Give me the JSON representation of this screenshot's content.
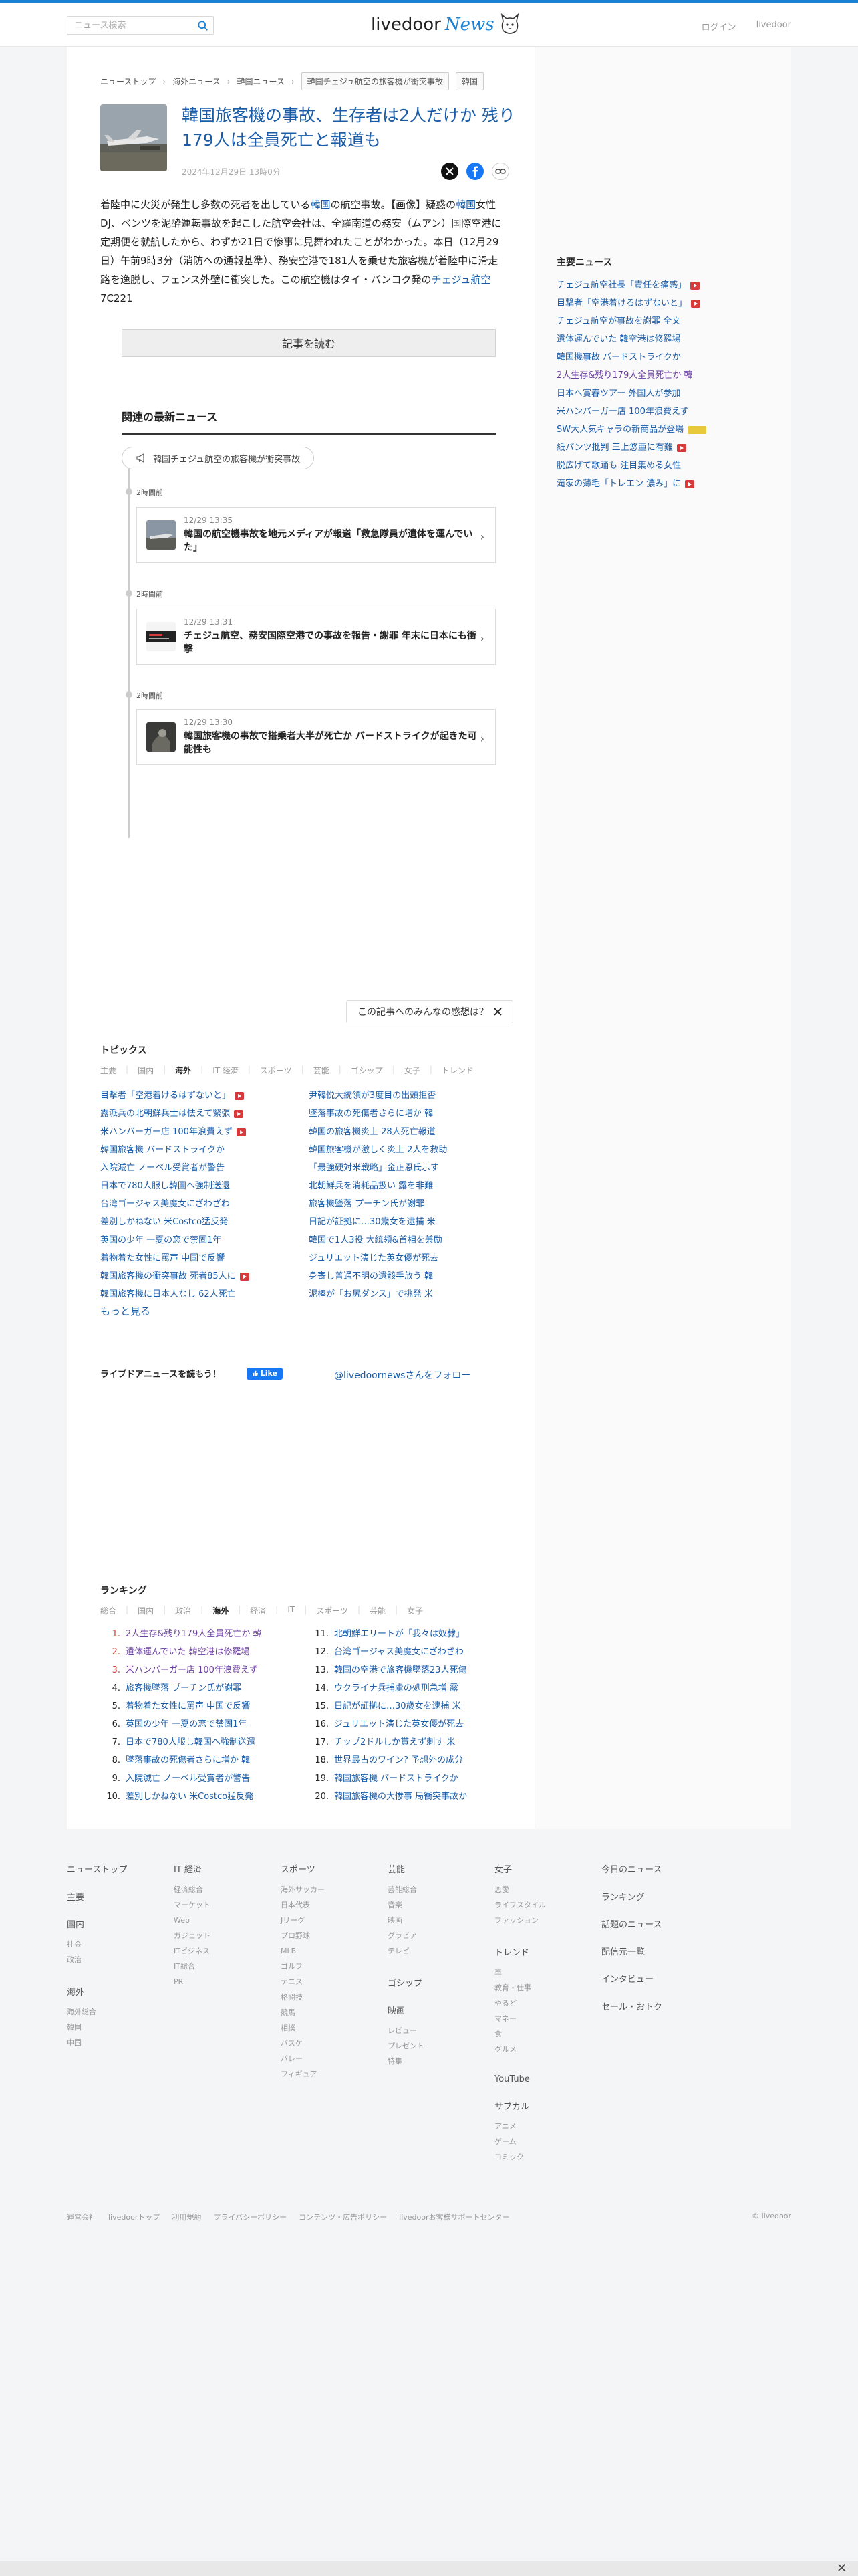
{
  "header": {
    "search_placeholder": "ニュース検索",
    "logo_main": "livedoor",
    "logo_news": "News",
    "login": "ログイン",
    "livedoor_link": "livedoor"
  },
  "breadcrumb": [
    "ニューストップ",
    "海外ニュース",
    "韓国ニュース"
  ],
  "breadcrumb_current": "韓国チェジュ航空の旅客機が衝突事故",
  "breadcrumb_tag": "韓国",
  "article": {
    "title": "韓国旅客機の事故、生存者は2人だけか 残り179人は全員死亡と報道も",
    "date": "2024年12月29日 13時0分",
    "body": [
      {
        "t": "着陸中に火災が発生し多数の死者を出している",
        "k": false
      },
      {
        "t": "韓国",
        "k": true
      },
      {
        "t": "の航空事故。【画像】疑惑の",
        "k": false
      },
      {
        "t": "韓国",
        "k": true
      },
      {
        "t": "女性DJ、ベンツを泥酔運転事故を起こした航空会社は、全羅南道の務安（ムアン）国際空港に定期便を就航したから、わずか21日で惨事に見舞われたことがわかった。本日（12月29日）午前9時3分（消防への通報基準）、務安空港で181人を乗せた旅客機が着陸中に滑走路を逸脱し、フェンス外壁に衝突した。この航空機はタイ・バンコク発の",
        "k": false
      },
      {
        "t": "チェジュ航空",
        "k": true
      },
      {
        "t": "7C221",
        "k": false
      }
    ],
    "read_more": "記事を読む"
  },
  "related": {
    "title": "関連の最新ニュース",
    "topic": "韓国チェジュ航空の旅客機が衝突事故",
    "items": [
      {
        "label": "2時間前",
        "time": "12/29 13:35",
        "headline": "韓国の航空機事故を地元メディアが報道「救急隊員が遺体を運んでいた」"
      },
      {
        "label": "2時間前",
        "time": "12/29 13:31",
        "headline": "チェジュ航空、務安国際空港での事故を報告・謝罪 年末に日本にも衝撃"
      },
      {
        "label": "2時間前",
        "time": "12/29 13:30",
        "headline": "韓国旅客機の事故で搭乗者大半が死亡か バードストライクが起きた可能性も"
      }
    ]
  },
  "opinion": "この記事へのみんなの感想は？",
  "topics": {
    "title": "トピックス",
    "tabs": [
      "主要",
      "国内",
      "海外",
      "IT 経済",
      "スポーツ",
      "芸能",
      "ゴシップ",
      "女子",
      "トレンド"
    ],
    "active_tab": "海外",
    "left": [
      {
        "t": "目撃者「空港着けるはずないと」",
        "badge": true
      },
      {
        "t": "露派兵の北朝鮮兵士は怯えて緊張",
        "badge": true
      },
      {
        "t": "米ハンバーガー店 100年浪費えず",
        "badge": true
      },
      {
        "t": "韓国旅客機 バードストライクか",
        "badge": false
      },
      {
        "t": "入院滅亡 ノーベル受賞者が警告",
        "badge": false
      },
      {
        "t": "日本で780人服し韓国へ強制送還",
        "badge": false
      },
      {
        "t": "台湾ゴージャス美魔女にざわざわ",
        "badge": false
      },
      {
        "t": "差別しかねない 米Costco猛反発",
        "badge": false
      },
      {
        "t": "英国の少年 一夏の恋で禁固1年",
        "badge": false
      },
      {
        "t": "着物着た女性に罵声 中国で反響",
        "badge": false
      },
      {
        "t": "韓国旅客機の衝突事故 死者85人に",
        "badge": true
      },
      {
        "t": "韓国旅客機に日本人なし 62人死亡",
        "badge": false
      }
    ],
    "right": [
      {
        "t": "尹韓悦大統領が3度目の出頭拒否"
      },
      {
        "t": "墜落事故の死傷者さらに増か 韓"
      },
      {
        "t": "韓国の旅客機炎上 28人死亡報道"
      },
      {
        "t": "韓国旅客機が激しく炎上 2人を救助"
      },
      {
        "t": "「最強硬対米戦略」金正恩氏示す"
      },
      {
        "t": "北朝鮮兵を消耗品扱い 露を非難"
      },
      {
        "t": "旅客機墜落 プーチン氏が謝罪"
      },
      {
        "t": "日記が証拠に…30歳女を逮捕 米"
      },
      {
        "t": "韓国で1人3役 大統領&首相を兼励"
      },
      {
        "t": "ジュリエット演じた英女優が死去"
      },
      {
        "t": "身寄し普通不明の遺骸手放う 韓"
      },
      {
        "t": "泥棒が「お尻ダンス」で挑発 米"
      }
    ],
    "more": "もっと見る"
  },
  "social": {
    "label": "ライブドアニュースを読もう！",
    "like": "Like",
    "follow": "@livedoornewsさんをフォロー"
  },
  "ranking": {
    "title": "ランキング",
    "tabs": [
      "総合",
      "国内",
      "政治",
      "海外",
      "経済",
      "IT",
      "スポーツ",
      "芸能",
      "女子"
    ],
    "active_tab": "海外",
    "left": [
      {
        "n": "1.",
        "t": "2人生存&残り179人全員死亡か 韓",
        "hot": true
      },
      {
        "n": "2.",
        "t": "遺体運んでいた 韓空港は修羅場",
        "hot": true
      },
      {
        "n": "3.",
        "t": "米ハンバーガー店 100年浪費えず",
        "hot": true
      },
      {
        "n": "4.",
        "t": "旅客機墜落 プーチン氏が謝罪",
        "hot": false
      },
      {
        "n": "5.",
        "t": "着物着た女性に罵声 中国で反響",
        "hot": false
      },
      {
        "n": "6.",
        "t": "英国の少年 一夏の恋で禁固1年",
        "hot": false
      },
      {
        "n": "7.",
        "t": "日本で780人服し韓国へ強制送還",
        "hot": false
      },
      {
        "n": "8.",
        "t": "墜落事故の死傷者さらに増か 韓",
        "hot": false
      },
      {
        "n": "9.",
        "t": "入院滅亡 ノーベル受賞者が警告",
        "hot": false
      },
      {
        "n": "10.",
        "t": "差別しかねない 米Costco猛反発",
        "hot": false
      }
    ],
    "right": [
      {
        "n": "11.",
        "t": "北朝鮮エリートが「我々は奴隷」"
      },
      {
        "n": "12.",
        "t": "台湾ゴージャス美魔女にざわざわ"
      },
      {
        "n": "13.",
        "t": "韓国の空港で旅客機墜落23人死傷"
      },
      {
        "n": "14.",
        "t": "ウクライナ兵捕虜の処刑急増 露"
      },
      {
        "n": "15.",
        "t": "日記が証拠に…30歳女を逮捕 米"
      },
      {
        "n": "16.",
        "t": "ジュリエット演じた英女優が死去"
      },
      {
        "n": "17.",
        "t": "チップ2ドルしか貰えず刺す 米"
      },
      {
        "n": "18.",
        "t": "世界最古のワイン? 予想外の成分"
      },
      {
        "n": "19.",
        "t": "韓国旅客機 バードストライクか"
      },
      {
        "n": "20.",
        "t": "韓国旅客機の大惨事 局衝突事故か"
      }
    ]
  },
  "sidebar": {
    "title": "主要ニュース",
    "items": [
      {
        "t": "チェジュ航空社長「責任を痛感」",
        "badge": "red",
        "visited": false
      },
      {
        "t": "目撃者「空港着けるはずないと」",
        "badge": "red",
        "visited": false
      },
      {
        "t": "チェジュ航空が事故を謝罪 全文",
        "badge": "",
        "visited": false
      },
      {
        "t": "遺体運んでいた 韓空港は修羅場",
        "badge": "",
        "visited": false
      },
      {
        "t": "韓国機事故 バードストライクか",
        "badge": "",
        "visited": false
      },
      {
        "t": "2人生存&残り179人全員死亡か 韓",
        "badge": "",
        "visited": true
      },
      {
        "t": "日本へ賞春ツアー 外国人が参加",
        "badge": "",
        "visited": false
      },
      {
        "t": "米ハンバーガー店 100年浪費えず",
        "badge": "",
        "visited": false
      },
      {
        "t": "SW大人気キャラの新商品が登場",
        "badge": "yellow",
        "visited": false
      },
      {
        "t": "紙パンツ批判 三上悠亜に有難",
        "badge": "red",
        "visited": false
      },
      {
        "t": "脱広げて歌踊も 注目集める女性",
        "badge": "",
        "visited": false
      },
      {
        "t": "滝家の薄毛「トレエン 濃み」に",
        "badge": "red",
        "visited": false
      }
    ]
  },
  "footer": {
    "columns": [
      {
        "groups": [
          {
            "head": "ニューストップ",
            "items": []
          },
          {
            "head": "主要",
            "items": []
          },
          {
            "head": "国内",
            "items": [
              "社会",
              "政治"
            ]
          },
          {
            "head": "海外",
            "items": [
              "海外総合",
              "韓国",
              "中国"
            ]
          }
        ]
      },
      {
        "groups": [
          {
            "head": "IT 経済",
            "items": [
              "経済総合",
              "マーケット",
              "Web",
              "ガジェット",
              "ITビジネス",
              "IT総合",
              "PR"
            ]
          }
        ]
      },
      {
        "groups": [
          {
            "head": "スポーツ",
            "items": [
              "海外サッカー",
              "日本代表",
              "Jリーグ",
              "プロ野球",
              "MLB",
              "ゴルフ",
              "テニス",
              "格闘技",
              "競馬",
              "相撲",
              "バスケ",
              "バレー",
              "フィギュア"
            ]
          }
        ]
      },
      {
        "groups": [
          {
            "head": "芸能",
            "items": [
              "芸能総合",
              "音楽",
              "映画",
              "グラビア",
              "テレビ"
            ]
          },
          {
            "head": "ゴシップ",
            "items": []
          },
          {
            "head": "映画",
            "items": [
              "レビュー",
              "プレゼント",
              "特集"
            ]
          }
        ]
      },
      {
        "groups": [
          {
            "head": "女子",
            "items": [
              "恋愛",
              "ライフスタイル",
              "ファッション"
            ]
          },
          {
            "head": "トレンド",
            "items": [
              "車",
              "教育・仕事",
              "やるど",
              "マネー",
              "食",
              "グルメ"
            ]
          },
          {
            "head": "YouTube",
            "items": []
          },
          {
            "head": "サブカル",
            "items": [
              "アニメ",
              "ゲーム",
              "コミック"
            ]
          }
        ]
      },
      {
        "groups": [
          {
            "head": "今日のニュース",
            "items": []
          },
          {
            "head": "ランキング",
            "items": []
          },
          {
            "head": "話題のニュース",
            "items": []
          },
          {
            "head": "配信元一覧",
            "items": []
          },
          {
            "head": "インタビュー",
            "items": []
          },
          {
            "head": "セール・おトク",
            "items": []
          }
        ]
      }
    ],
    "bottom_links": [
      "運営会社",
      "livedoorトップ",
      "利用規約",
      "プライバシーポリシー",
      "コンテンツ・広告ポリシー",
      "livedoorお客様サポートセンター"
    ],
    "copyright": "© livedoor"
  }
}
